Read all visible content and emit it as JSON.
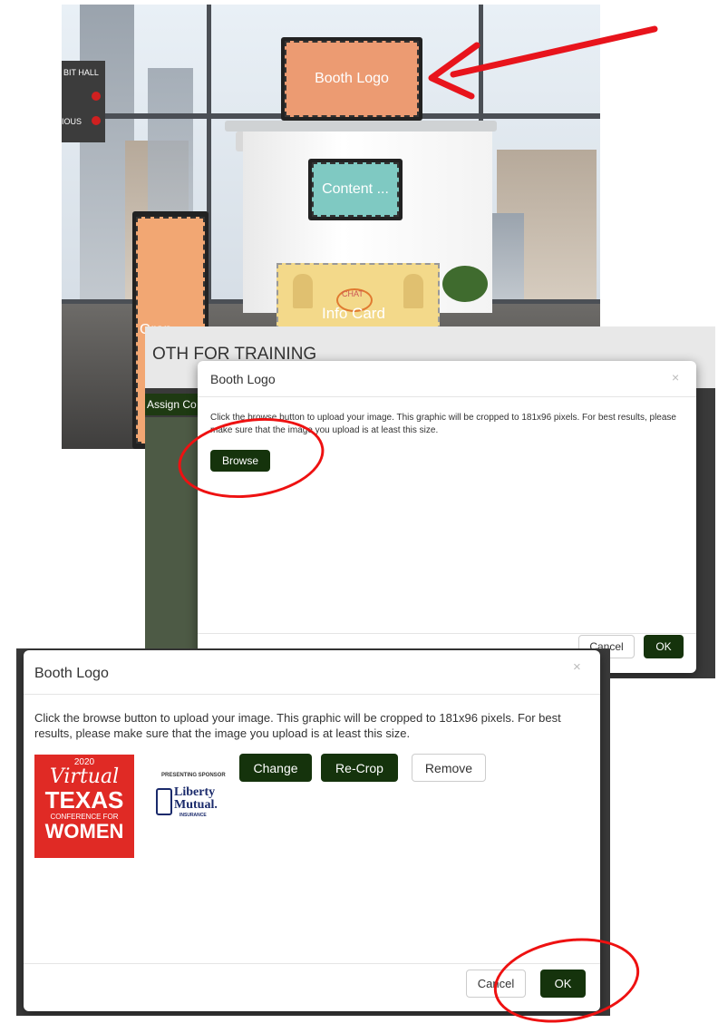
{
  "scene": {
    "booth_logo_label": "Booth Logo",
    "content_label": "Content ...",
    "graphic_label": "Grap...",
    "info_card_label": "Info Card",
    "chat_label": "CHAT",
    "exhibit_hall_label": "BIT HALL",
    "sign_label_2": "IOUS"
  },
  "colors": {
    "booth_logo_slot": "#ec9b72",
    "content_slot": "#7fc9c2",
    "graphic_slot": "#f2a773",
    "info_card_slot": "#f3d98a",
    "accent_red": "#e8141c",
    "button_green": "#15330c"
  },
  "panel2": {
    "background_title": "OTH FOR TRAINING",
    "background_tab": "Assign Co",
    "dialog": {
      "title": "Booth Logo",
      "close": "×",
      "instructions": "Click the browse button to upload your image. This graphic will be cropped to 181x96 pixels. For best results, please make sure that the image you upload is at least this size.",
      "browse_button": "Browse",
      "cancel_button": "Cancel",
      "ok_button": "OK"
    }
  },
  "panel3": {
    "dialog": {
      "title": "Booth Logo",
      "close": "×",
      "instructions": "Click the browse button to upload your image. This graphic will be cropped to 181x96 pixels. For best results, please make sure that the image you upload is at least this size.",
      "change_button": "Change",
      "recrop_button": "Re-Crop",
      "remove_button": "Remove",
      "cancel_button": "Cancel",
      "ok_button": "OK"
    },
    "logo": {
      "year": "2020",
      "virtual": "Virtual",
      "texas": "TEXAS",
      "conference_for": "CONFERENCE FOR",
      "women": "WOMEN"
    },
    "sponsor": {
      "presenting": "PRESENTING SPONSOR",
      "liberty": "Liberty",
      "mutual": "Mutual.",
      "insurance": "INSURANCE"
    }
  },
  "icons": {
    "arrow": "red-arrow-icon",
    "highlight": "red-circle-highlight"
  }
}
